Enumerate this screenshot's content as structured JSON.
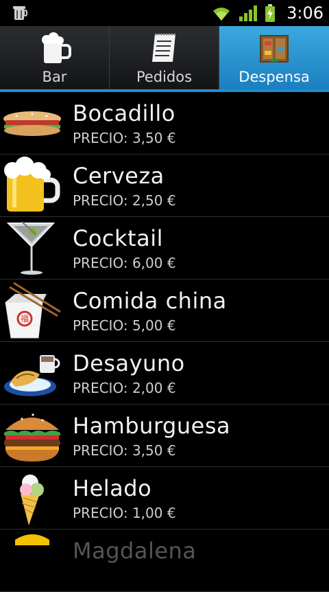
{
  "status": {
    "time": "3:06"
  },
  "tabs": [
    {
      "label": "Bar",
      "active": false,
      "icon": "beer-mug-icon"
    },
    {
      "label": "Pedidos",
      "active": false,
      "icon": "notepad-icon"
    },
    {
      "label": "Despensa",
      "active": true,
      "icon": "pantry-icon"
    }
  ],
  "items": [
    {
      "name": "Bocadillo",
      "price": "PRECIO: 3,50 €",
      "icon": "sandwich-icon"
    },
    {
      "name": "Cerveza",
      "price": "PRECIO: 2,50 €",
      "icon": "beer-icon"
    },
    {
      "name": "Cocktail",
      "price": "PRECIO: 6,00 €",
      "icon": "cocktail-icon"
    },
    {
      "name": "Comida china",
      "price": "PRECIO: 5,00 €",
      "icon": "chinese-takeout-icon"
    },
    {
      "name": "Desayuno",
      "price": "PRECIO: 2,00 €",
      "icon": "breakfast-icon"
    },
    {
      "name": "Hamburguesa",
      "price": "PRECIO: 3,50 €",
      "icon": "hamburger-icon"
    },
    {
      "name": "Helado",
      "price": "PRECIO: 1,00 €",
      "icon": "ice-cream-icon"
    },
    {
      "name": "Magdalena",
      "price": "",
      "icon": "muffin-icon"
    }
  ],
  "colors": {
    "accent": "#1f8fd0",
    "tab_active": "#2f9bd6",
    "background": "#000000"
  }
}
